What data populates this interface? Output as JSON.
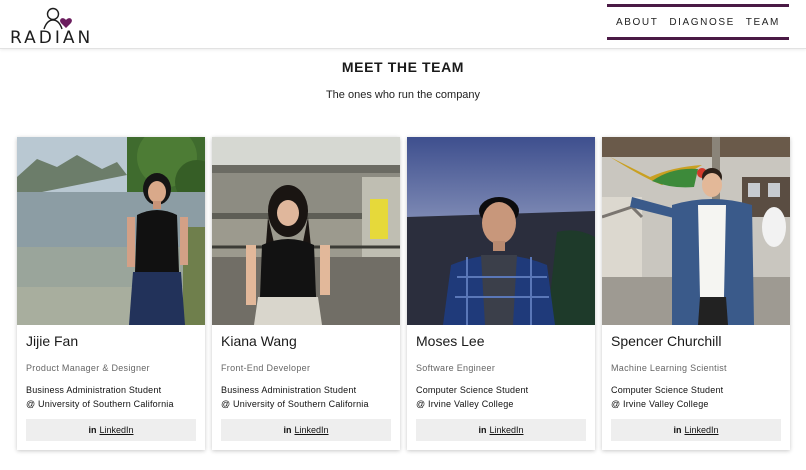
{
  "brand": {
    "name": "RADIAN",
    "accent_color": "#4a1a45",
    "heart_color": "#6b1d5e"
  },
  "nav": {
    "items": [
      "ABOUT",
      "DIAGNOSE",
      "TEAM"
    ]
  },
  "page": {
    "title": "MEET THE TEAM",
    "subtitle": "The ones who run the company"
  },
  "team": [
    {
      "name": "Jijie Fan",
      "role": "Product Manager & Designer",
      "edu_line1": "Business Administration Student",
      "edu_line2": "@ University of Southern California",
      "link_icon": "in",
      "link_label": "LinkedIn"
    },
    {
      "name": "Kiana Wang",
      "role": "Front-End Developer",
      "edu_line1": "Business Administration Student",
      "edu_line2": "@ University of Southern California",
      "link_icon": "in",
      "link_label": "LinkedIn"
    },
    {
      "name": "Moses Lee",
      "role": "Software Engineer",
      "edu_line1": "Computer Science Student",
      "edu_line2": "@ Irvine Valley College",
      "link_icon": "in",
      "link_label": "LinkedIn"
    },
    {
      "name": "Spencer Churchill",
      "role": "Machine Learning Scientist",
      "edu_line1": "Computer Science Student",
      "edu_line2": "@ Irvine Valley College",
      "link_icon": "in",
      "link_label": "LinkedIn"
    }
  ]
}
